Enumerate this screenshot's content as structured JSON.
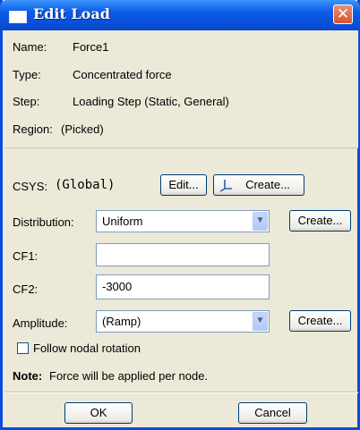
{
  "window": {
    "title": "Edit Load",
    "close_glyph": "✕"
  },
  "info": {
    "name_label": "Name:",
    "name_value": "Force1",
    "type_label": "Type:",
    "type_value": "Concentrated force",
    "step_label": "Step:",
    "step_value": "Loading Step (Static, General)",
    "region_label": "Region:",
    "region_value": "(Picked)"
  },
  "csys": {
    "label": "CSYS:",
    "value": "(Global)",
    "edit_button": "Edit...",
    "create_button": "Create..."
  },
  "distribution": {
    "label": "Distribution:",
    "selected": "Uniform",
    "create_button": "Create..."
  },
  "cf1": {
    "label": "CF1:",
    "value": ""
  },
  "cf2": {
    "label": "CF2:",
    "value": "-3000"
  },
  "amplitude": {
    "label": "Amplitude:",
    "selected": "(Ramp)",
    "create_button": "Create..."
  },
  "follow_nodal": {
    "label": "Follow nodal rotation",
    "checked": false
  },
  "note": {
    "prefix": "Note:",
    "text": "Force will be applied per node."
  },
  "footer": {
    "ok_button": "OK",
    "cancel_button": "Cancel"
  }
}
